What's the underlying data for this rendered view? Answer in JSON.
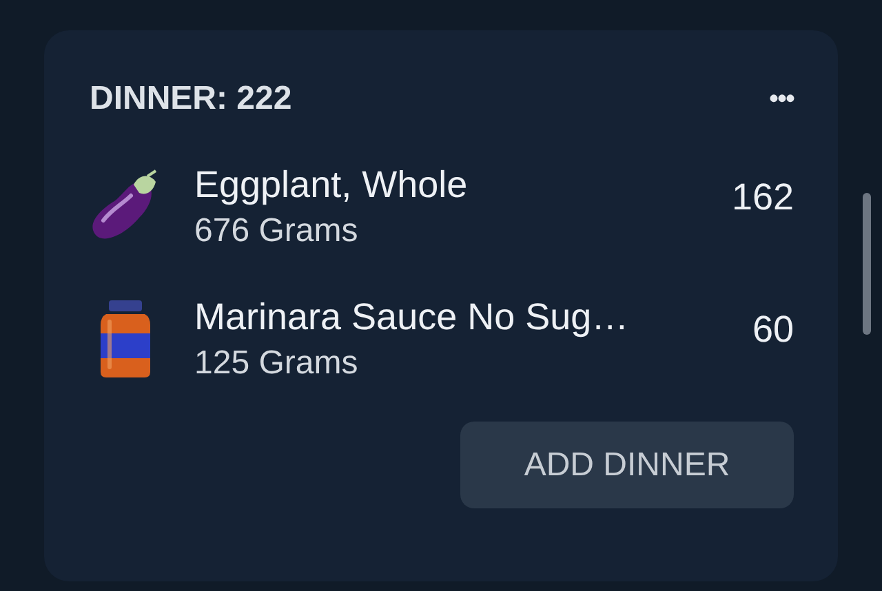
{
  "meal": {
    "title": "DINNER: 222",
    "menu": "•••"
  },
  "items": [
    {
      "kind": "eggplant",
      "name": "Eggplant, Whole",
      "amount": "676 Grams",
      "calories": "162"
    },
    {
      "kind": "jar",
      "name": "Marinara Sauce No Sug…",
      "amount": "125 Grams",
      "calories": "60"
    }
  ],
  "button": "ADD DINNER"
}
